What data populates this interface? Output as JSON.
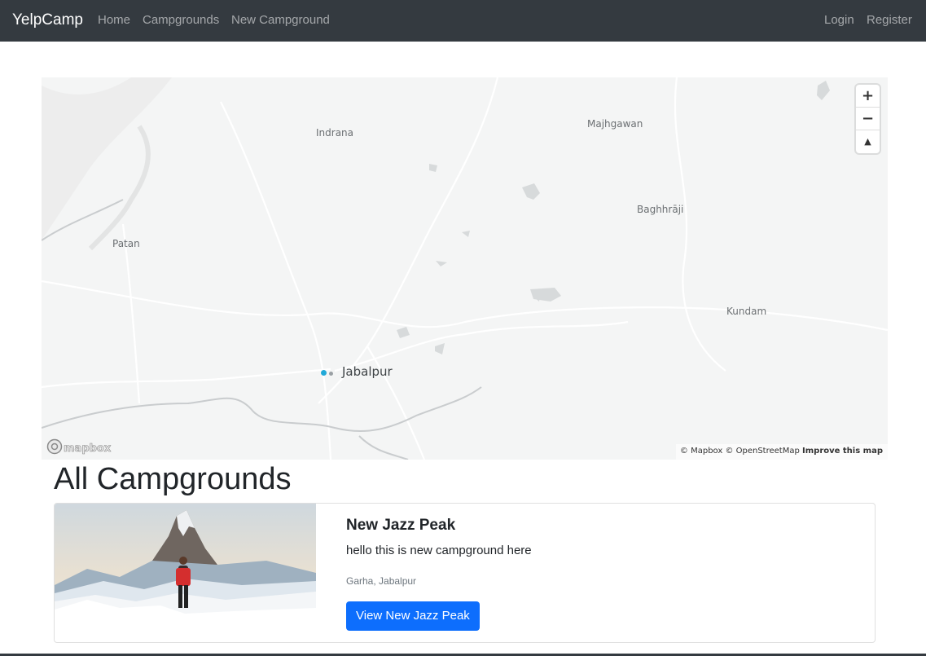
{
  "navbar": {
    "brand": "YelpCamp",
    "links": [
      "Home",
      "Campgrounds",
      "New Campground"
    ],
    "auth": [
      "Login",
      "Register"
    ]
  },
  "map": {
    "places": {
      "indrana": "Indrana",
      "majhgawan": "Majhgawan",
      "baghhraji": "Baghhrāji",
      "patan": "Patan",
      "kundam": "Kundam",
      "jabalpur": "Jabalpur"
    },
    "controls": {
      "zoom_in": "+",
      "zoom_out": "−",
      "compass": "▲"
    },
    "logo_text": "mapbox",
    "attribution": "© Mapbox © OpenStreetMap",
    "improve": "Improve this map"
  },
  "page": {
    "title": "All Campgrounds"
  },
  "campgrounds": [
    {
      "title": "New Jazz Peak",
      "description": "hello this is new campground here",
      "location": "Garha, Jabalpur",
      "button": "View New Jazz Peak"
    }
  ],
  "colors": {
    "navbar": "#343a40",
    "primary": "#0d6efd",
    "marker": "#21a9d8"
  }
}
